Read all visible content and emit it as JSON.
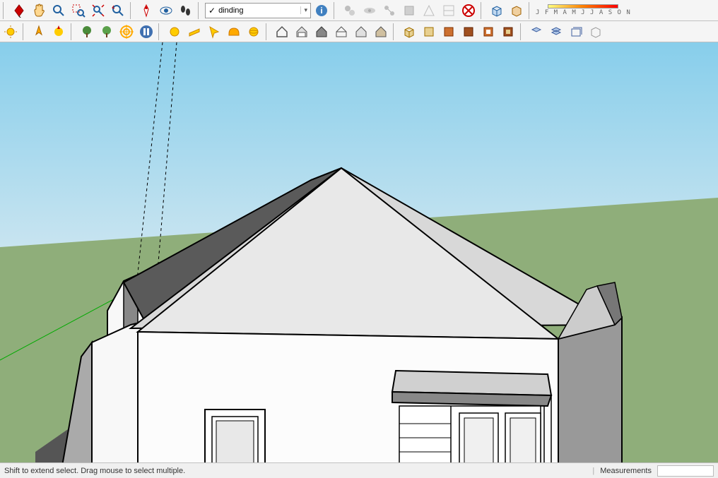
{
  "toolbar1": {
    "layer_selected": "dinding",
    "months": "J F M A M J J A S O N"
  },
  "status": {
    "hint": "Shift to extend select. Drag mouse to select multiple.",
    "measurements_label": "Measurements"
  },
  "icons": {
    "select": "select-icon",
    "pan": "pan-hand-icon",
    "zoom": "zoom-icon",
    "zoom_window": "zoom-window-icon",
    "zoom_extents": "zoom-extents-icon",
    "previous": "zoom-previous-icon",
    "undo_view": "undo-view-icon",
    "orbit": "orbit-icon",
    "look": "look-around-icon",
    "walk": "walk-icon",
    "layer_info": "info-icon"
  }
}
